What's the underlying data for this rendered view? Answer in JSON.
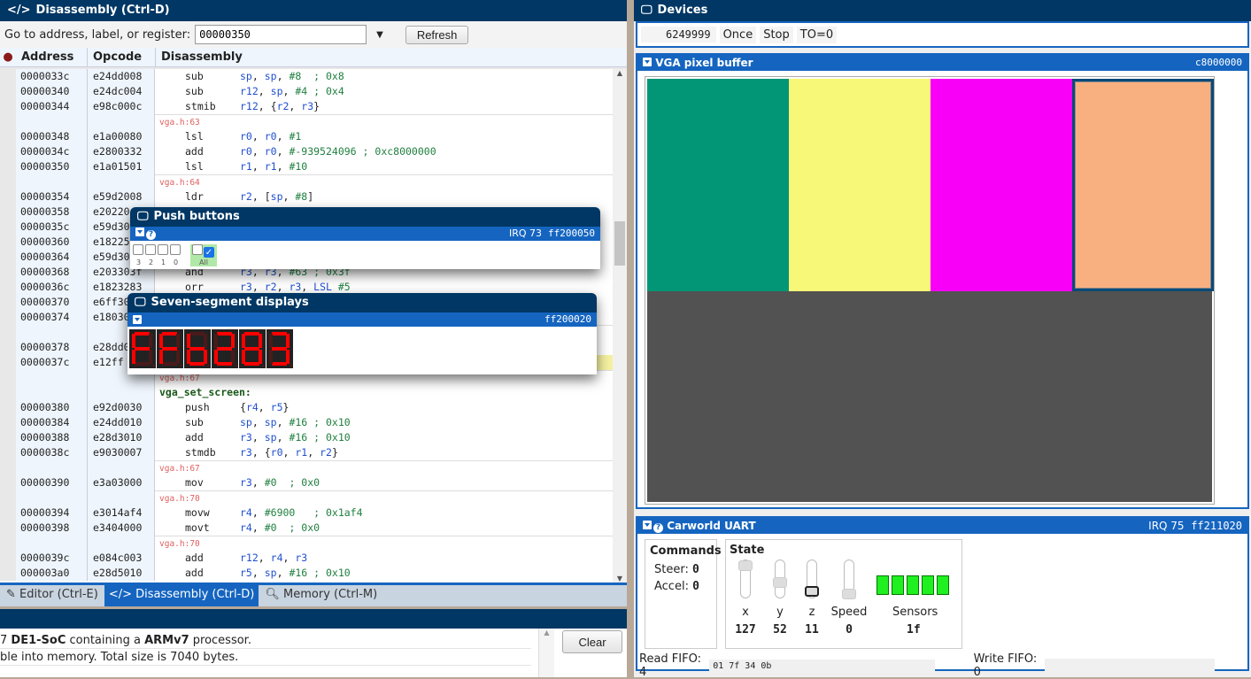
{
  "disassembly": {
    "title": "Disassembly (Ctrl-D)",
    "goto_label": "Go to address, label, or register:",
    "goto_value": "00000350",
    "refresh_label": "Refresh",
    "columns": [
      "Address",
      "Opcode",
      "Disassembly"
    ],
    "rows": [
      {
        "addr": "0000033c",
        "op": "e24dd008",
        "mn": "sub",
        "args": "sp, sp, #8  ; 0x8"
      },
      {
        "addr": "00000340",
        "op": "e24dc004",
        "mn": "sub",
        "args": "r12, sp, #4 ; 0x4"
      },
      {
        "addr": "00000344",
        "op": "e98c000c",
        "mn": "stmib",
        "args": "r12, {r2, r3}"
      },
      {
        "src": "vga.h:63"
      },
      {
        "addr": "00000348",
        "op": "e1a00080",
        "mn": "lsl",
        "args": "r0, r0, #1"
      },
      {
        "addr": "0000034c",
        "op": "e2800332",
        "mn": "add",
        "args": "r0, r0, #-939524096 ; 0xc8000000"
      },
      {
        "addr": "00000350",
        "op": "e1a01501",
        "mn": "lsl",
        "args": "r1, r1, #10"
      },
      {
        "src": "vga.h:64"
      },
      {
        "addr": "00000354",
        "op": "e59d2008",
        "mn": "ldr",
        "args": "r2, [sp, #8]"
      },
      {
        "addr": "00000358",
        "op": "e20220",
        "mn": "",
        "args": ""
      },
      {
        "addr": "0000035c",
        "op": "e59d30",
        "mn": "",
        "args": ""
      },
      {
        "addr": "00000360",
        "op": "e18225",
        "mn": "",
        "args": ""
      },
      {
        "addr": "00000364",
        "op": "e59d30",
        "mn": "",
        "args": ""
      },
      {
        "addr": "00000368",
        "op": "e203303f",
        "mn": "and",
        "args": "r3, r3, #63 ; 0x3f"
      },
      {
        "addr": "0000036c",
        "op": "e1823283",
        "mn": "orr",
        "args": "r3, r2, r3, LSL #5"
      },
      {
        "addr": "00000370",
        "op": "e6ff30",
        "mn": "",
        "args": ""
      },
      {
        "addr": "00000374",
        "op": "e18030",
        "mn": "",
        "args": ""
      },
      {
        "src": ""
      },
      {
        "addr": "00000378",
        "op": "e28dd0",
        "mn": "",
        "args": ""
      },
      {
        "addr": "0000037c",
        "op": "e12ff",
        "mn": "",
        "args": "",
        "hl": true
      },
      {
        "src": "vga.h:67"
      },
      {
        "label": "vga_set_screen:"
      },
      {
        "addr": "00000380",
        "op": "e92d0030",
        "mn": "push",
        "args": "{r4, r5}"
      },
      {
        "addr": "00000384",
        "op": "e24dd010",
        "mn": "sub",
        "args": "sp, sp, #16 ; 0x10"
      },
      {
        "addr": "00000388",
        "op": "e28d3010",
        "mn": "add",
        "args": "r3, sp, #16 ; 0x10"
      },
      {
        "addr": "0000038c",
        "op": "e9030007",
        "mn": "stmdb",
        "args": "r3, {r0, r1, r2}"
      },
      {
        "src": "vga.h:67"
      },
      {
        "addr": "00000390",
        "op": "e3a03000",
        "mn": "mov",
        "args": "r3, #0  ; 0x0"
      },
      {
        "src": "vga.h:70"
      },
      {
        "addr": "00000394",
        "op": "e3014af4",
        "mn": "movw",
        "args": "r4, #6900   ; 0x1af4"
      },
      {
        "addr": "00000398",
        "op": "e3404000",
        "mn": "movt",
        "args": "r4, #0  ; 0x0"
      },
      {
        "src": "vga.h:70"
      },
      {
        "addr": "0000039c",
        "op": "e084c003",
        "mn": "add",
        "args": "r12, r4, r3"
      },
      {
        "addr": "000003a0",
        "op": "e28d5010",
        "mn": "add",
        "args": "r5, sp, #16 ; 0x10"
      }
    ],
    "tabs": [
      "Editor (Ctrl-E)",
      "Disassembly (Ctrl-D)",
      "Memory (Ctrl-M)"
    ]
  },
  "messages": {
    "lines": [
      {
        "pre": "7 ",
        "b1": "DE1-SoC",
        "mid": " containing a ",
        "b2": "ARMv7",
        "post": " processor."
      },
      {
        "pre": "ble into memory. Total size is 7040 bytes.",
        "b1": "",
        "mid": "",
        "b2": "",
        "post": ""
      }
    ],
    "clear_label": "Clear"
  },
  "devices": {
    "title": "Devices",
    "timer": {
      "value": "6249999",
      "once": "Once",
      "stop": "Stop",
      "to": "TO=0"
    },
    "vga": {
      "title": "VGA pixel buffer",
      "addr": "c8000000",
      "colors": [
        "#029677",
        "#f8f878",
        "#f800f8",
        "#f8b080"
      ],
      "bg": "#525252"
    },
    "uart": {
      "title": "Carworld UART",
      "irq": "IRQ 75",
      "addr": "ff211020",
      "commands_title": "Commands",
      "steer_label": "Steer:",
      "steer": "0",
      "accel_label": "Accel:",
      "accel": "0",
      "state_title": "State",
      "sliders": [
        {
          "label": "x",
          "value": "127",
          "level": 1.0
        },
        {
          "label": "y",
          "value": "52",
          "level": 0.41
        },
        {
          "label": "z",
          "value": "11",
          "level": 0.09
        },
        {
          "label": "Speed",
          "value": "0",
          "level": 0.0
        }
      ],
      "sensors_label": "Sensors",
      "sensors_value": "1f",
      "read_fifo_label": "Read FIFO: 4",
      "read_fifo_data": "01 7f 34 0b",
      "write_fifo_label": "Write FIFO: 0"
    }
  },
  "push_buttons": {
    "title": "Push buttons",
    "irq": "IRQ 73",
    "addr": "ff200050",
    "labels": [
      "3",
      "2",
      "1",
      "0"
    ],
    "all_label": "All"
  },
  "seven_seg": {
    "title": "Seven-segment displays",
    "addr": "ff200020",
    "digits": [
      "F",
      "F",
      "b",
      "2",
      "8",
      "3"
    ]
  }
}
